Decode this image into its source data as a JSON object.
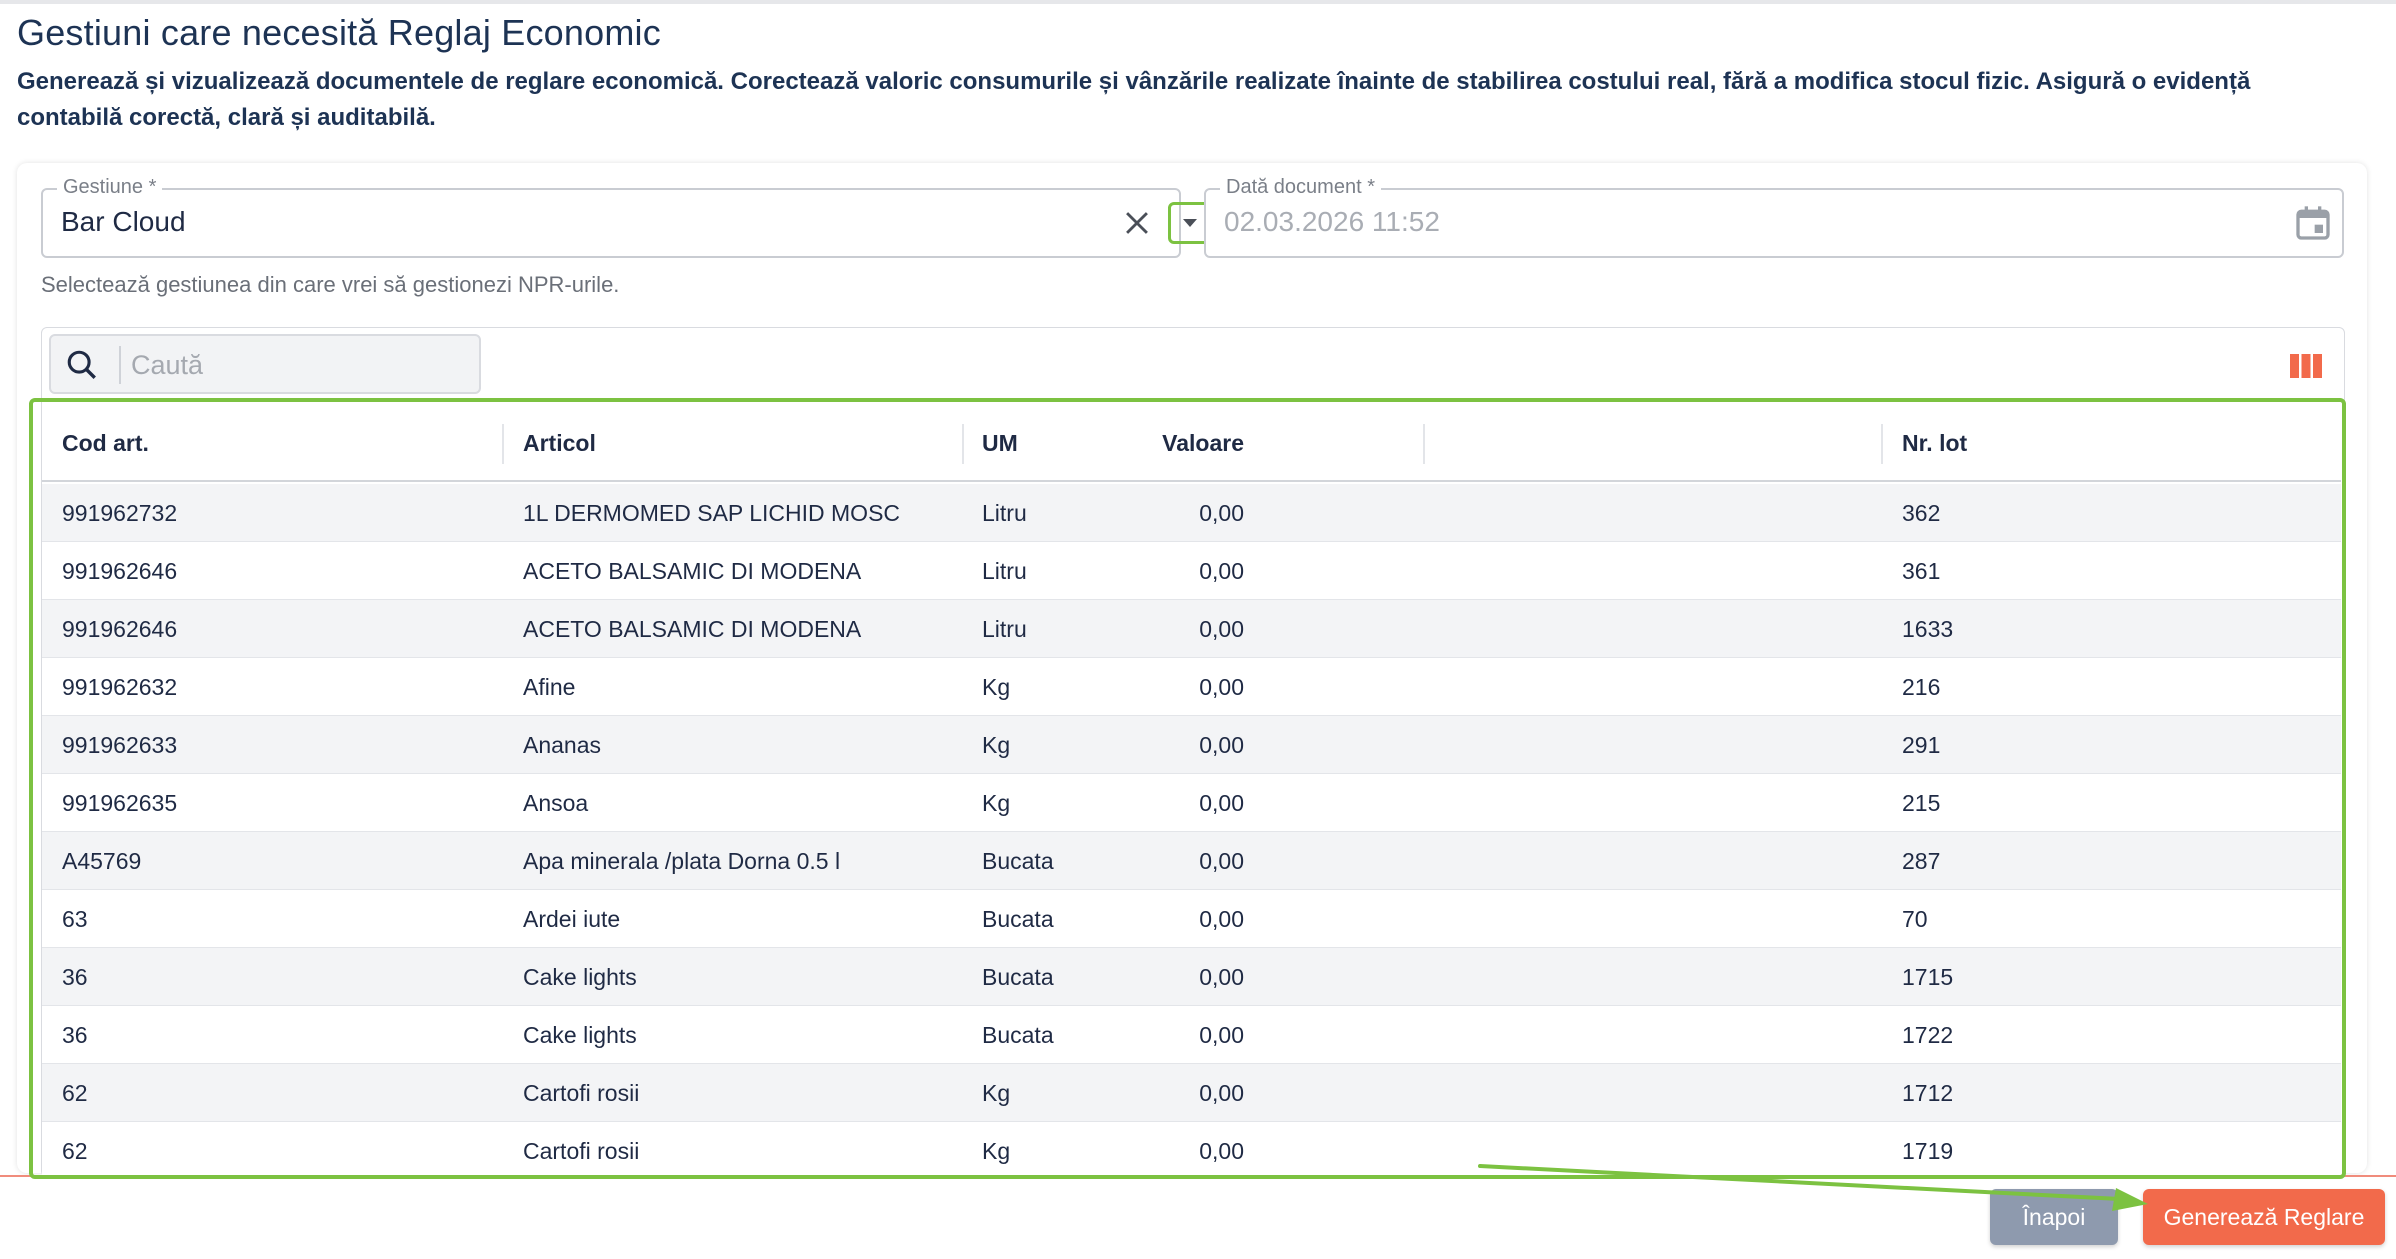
{
  "page": {
    "title": "Gestiuni care necesită Reglaj Economic",
    "description": "Generează și vizualizează documentele de reglare economică. Corectează valoric consumurile și vânzările realizate înainte de stabilirea costului real, fără a modifica stocul fizic. Asigură o evidență contabilă corectă, clară și auditabilă."
  },
  "form": {
    "gestiune_label": "Gestiune *",
    "gestiune_value": "Bar Cloud",
    "data_label": "Dată document *",
    "data_value": "02.03.2026 11:52",
    "helper": "Selectează gestiunea din care vrei să gestionezi NPR-urile."
  },
  "search": {
    "placeholder": "Caută"
  },
  "table": {
    "headers": [
      "Cod art.",
      "Articol",
      "UM",
      "Valoare",
      "Nr. lot"
    ],
    "rows": [
      [
        "991962732",
        "1L DERMOMED SAP LICHID MOSC",
        "Litru",
        "0,00",
        "362"
      ],
      [
        "991962646",
        "ACETO BALSAMIC DI MODENA",
        "Litru",
        "0,00",
        "361"
      ],
      [
        "991962646",
        "ACETO BALSAMIC DI MODENA",
        "Litru",
        "0,00",
        "1633"
      ],
      [
        "991962632",
        "Afine",
        "Kg",
        "0,00",
        "216"
      ],
      [
        "991962633",
        "Ananas",
        "Kg",
        "0,00",
        "291"
      ],
      [
        "991962635",
        "Ansoa",
        "Kg",
        "0,00",
        "215"
      ],
      [
        "A45769",
        "Apa minerala /plata Dorna 0.5 l",
        "Bucata",
        "0,00",
        "287"
      ],
      [
        "63",
        "Ardei iute",
        "Bucata",
        "0,00",
        "70"
      ],
      [
        "36",
        "Cake lights",
        "Bucata",
        "0,00",
        "1715"
      ],
      [
        "36",
        "Cake lights",
        "Bucata",
        "0,00",
        "1722"
      ],
      [
        "62",
        "Cartofi rosii",
        "Kg",
        "0,00",
        "1712"
      ],
      [
        "62",
        "Cartofi rosii",
        "Kg",
        "0,00",
        "1719"
      ]
    ]
  },
  "footer": {
    "back_label": "Înapoi",
    "generate_label": "Generează Reglare"
  },
  "icons": {
    "clear": "close-icon",
    "dropdown": "caret-down-icon",
    "calendar": "calendar-icon",
    "search": "search-icon",
    "columns": "columns-icon"
  },
  "colors": {
    "accent": "#f26a4b",
    "highlight": "#7cc241",
    "back_button": "#8e9aae",
    "title": "#1d3354"
  }
}
